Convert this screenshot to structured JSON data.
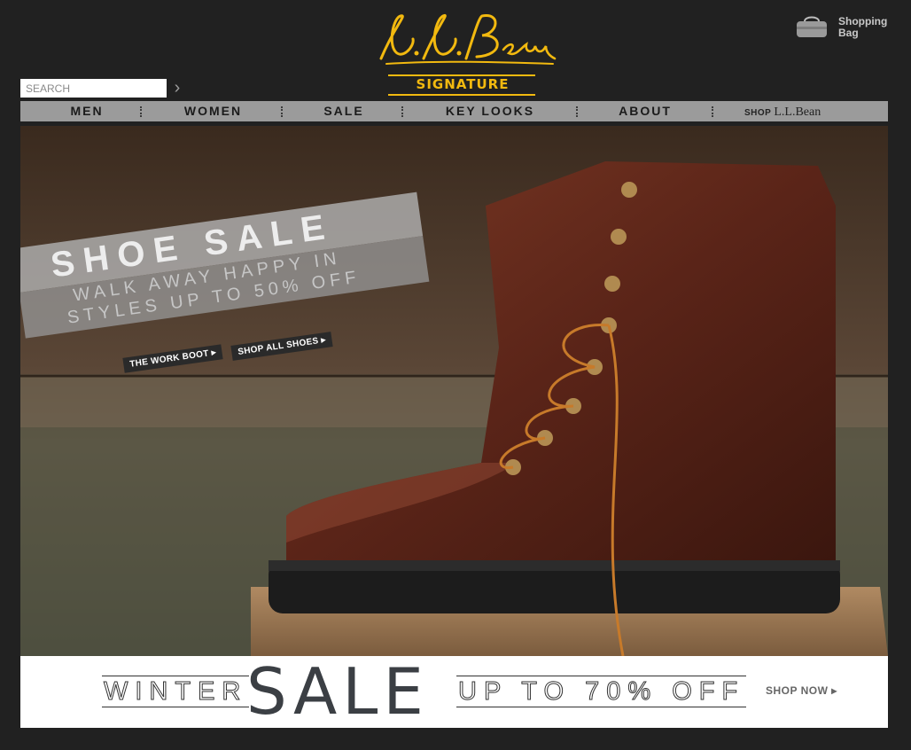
{
  "logo": {
    "script_text": "L.L.Bean",
    "signature": "SIGNATURE",
    "color": "#f2b90f"
  },
  "header": {
    "bag_label": "Shopping Bag",
    "bag_icon": "shopping-bag-icon"
  },
  "search": {
    "placeholder": "SEARCH",
    "submit_icon": "chevron-right-icon"
  },
  "nav": {
    "items": [
      {
        "label": "MEN"
      },
      {
        "label": "WOMEN"
      },
      {
        "label": "SALE"
      },
      {
        "label": "KEY LOOKS"
      },
      {
        "label": "ABOUT"
      }
    ],
    "shop_prefix": "SHOP",
    "shop_brand": "L.L.Bean"
  },
  "hero": {
    "title": "SHOE SALE",
    "subtitle_line1": "WALK AWAY HAPPY IN",
    "subtitle_line2": "STYLES UP TO 50% OFF",
    "cta_work_boot": "THE WORK BOOT ▸",
    "cta_all_shoes": "SHOP ALL SHOES ▸"
  },
  "promo": {
    "left": "WINTER",
    "main": "SALE",
    "right": "UP TO 70% OFF",
    "cta": "SHOP NOW ▸"
  }
}
